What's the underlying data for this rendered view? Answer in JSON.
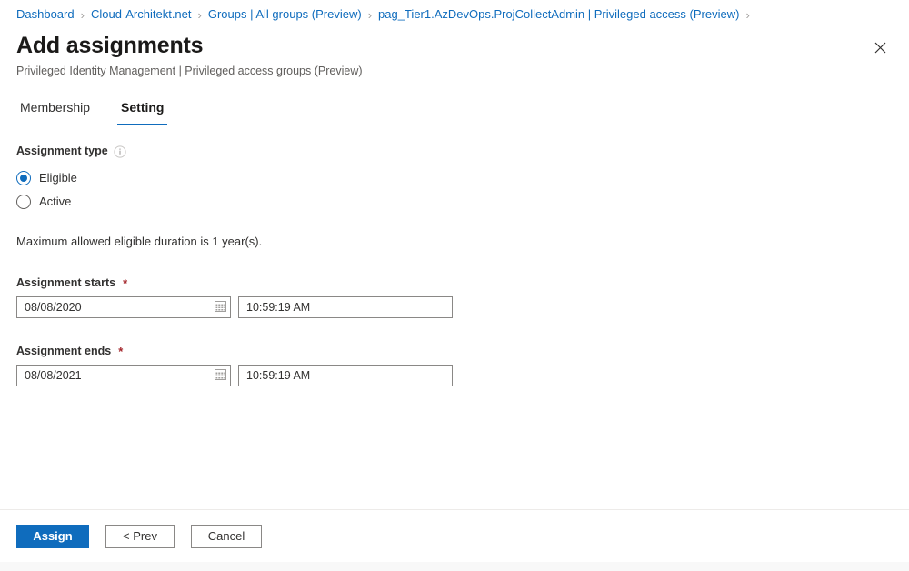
{
  "breadcrumb": {
    "separator": "›",
    "items": [
      {
        "label": "Dashboard"
      },
      {
        "label": "Cloud-Architekt.net"
      },
      {
        "label": "Groups | All groups (Preview)"
      },
      {
        "label": "pag_Tier1.AzDevOps.ProjCollectAdmin | Privileged access (Preview)"
      }
    ]
  },
  "header": {
    "title": "Add assignments",
    "subtitle": "Privileged Identity Management | Privileged access groups (Preview)",
    "close_icon": "close-icon"
  },
  "tabs": [
    {
      "label": "Membership",
      "active": false
    },
    {
      "label": "Setting",
      "active": true
    }
  ],
  "form": {
    "assignment_type": {
      "label": "Assignment type",
      "info_icon": "info-icon",
      "options": [
        {
          "label": "Eligible",
          "selected": true
        },
        {
          "label": "Active",
          "selected": false
        }
      ]
    },
    "note": "Maximum allowed eligible duration is 1 year(s).",
    "assignment_starts": {
      "label": "Assignment starts",
      "required_marker": "*",
      "date_value": "08/08/2020",
      "date_placeholder": "mm/dd/yyyy",
      "time_value": "10:59:19 AM",
      "time_placeholder": "hh:mm:ss AM",
      "calendar_icon": "calendar-icon"
    },
    "assignment_ends": {
      "label": "Assignment ends",
      "required_marker": "*",
      "date_value": "08/08/2021",
      "date_placeholder": "mm/dd/yyyy",
      "time_value": "10:59:19 AM",
      "time_placeholder": "hh:mm:ss AM",
      "calendar_icon": "calendar-icon"
    }
  },
  "footer": {
    "assign_label": "Assign",
    "prev_label": "< Prev",
    "cancel_label": "Cancel"
  },
  "colors": {
    "accent": "#0f6cbd",
    "link": "#0f6cbd",
    "required": "#a4262c",
    "border": "#8a8886",
    "text": "#323130",
    "muted": "#605e5c"
  }
}
